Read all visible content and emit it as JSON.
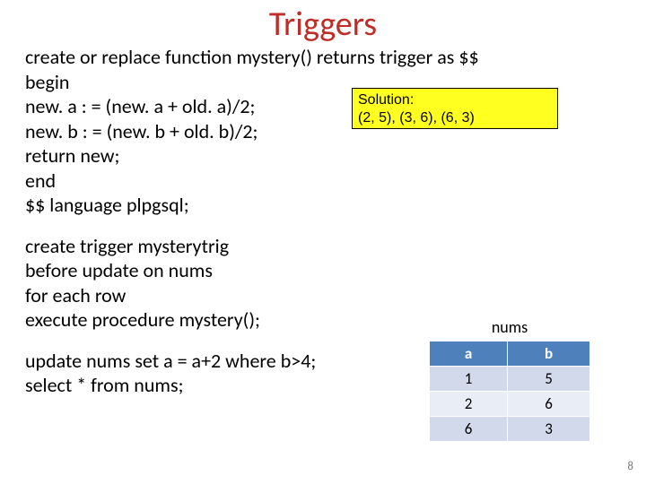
{
  "title": "Triggers",
  "code1": {
    "l1": "create or replace function mystery() returns trigger as $$",
    "l2": "begin",
    "l3": " new. a : = (new. a + old. a)/2;",
    "l4": " new. b : = (new. b + old. b)/2;",
    "l5": " return new;",
    "l6": "end",
    "l7": "$$ language plpgsql;"
  },
  "code2": {
    "l1": "create trigger mysterytrig",
    "l2": "before update on nums",
    "l3": "for each row",
    "l4": "execute procedure mystery();"
  },
  "code3": {
    "l1": "update nums set a = a+2 where b>4;",
    "l2": "select * from nums;"
  },
  "solution": {
    "label": "Solution:",
    "value": "(2, 5), (3, 6), (6, 3)"
  },
  "table": {
    "caption": "nums",
    "headers": {
      "c1": "a",
      "c2": "b"
    },
    "rows": [
      {
        "c1": "1",
        "c2": "5"
      },
      {
        "c1": "2",
        "c2": "6"
      },
      {
        "c1": "6",
        "c2": "3"
      }
    ]
  },
  "page_number": "8"
}
